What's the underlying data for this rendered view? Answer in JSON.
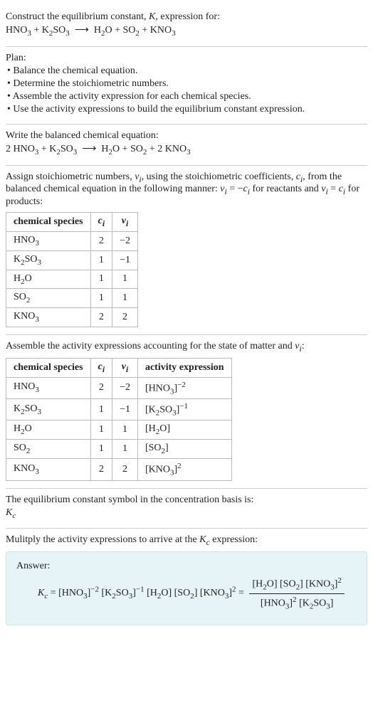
{
  "intro": {
    "lead": "Construct the equilibrium constant, K, expression for:",
    "equation": "HNO₃ + K₂SO₃ ⟶ H₂O + SO₂ + KNO₃"
  },
  "plan": {
    "heading": "Plan:",
    "items": [
      "• Balance the chemical equation.",
      "• Determine the stoichiometric numbers.",
      "• Assemble the activity expression for each chemical species.",
      "• Use the activity expressions to build the equilibrium constant expression."
    ]
  },
  "balanced": {
    "heading": "Write the balanced chemical equation:",
    "equation": "2 HNO₃ + K₂SO₃ ⟶ H₂O + SO₂ + 2 KNO₃"
  },
  "stoich": {
    "intro_before": "Assign stoichiometric numbers, νᵢ, using the stoichiometric coefficients, cᵢ, from the balanced chemical equation in the following manner: νᵢ = −cᵢ for reactants and νᵢ = cᵢ for products:",
    "headers": {
      "species": "chemical species",
      "ci": "cᵢ",
      "vi": "νᵢ"
    },
    "rows": [
      {
        "species": "HNO₃",
        "ci": "2",
        "vi": "−2"
      },
      {
        "species": "K₂SO₃",
        "ci": "1",
        "vi": "−1"
      },
      {
        "species": "H₂O",
        "ci": "1",
        "vi": "1"
      },
      {
        "species": "SO₂",
        "ci": "1",
        "vi": "1"
      },
      {
        "species": "KNO₃",
        "ci": "2",
        "vi": "2"
      }
    ]
  },
  "activity": {
    "intro": "Assemble the activity expressions accounting for the state of matter and νᵢ:",
    "headers": {
      "species": "chemical species",
      "ci": "cᵢ",
      "vi": "νᵢ",
      "act": "activity expression"
    },
    "rows": [
      {
        "species": "HNO₃",
        "ci": "2",
        "vi": "−2",
        "act": "[HNO₃]⁻²"
      },
      {
        "species": "K₂SO₃",
        "ci": "1",
        "vi": "−1",
        "act": "[K₂SO₃]⁻¹"
      },
      {
        "species": "H₂O",
        "ci": "1",
        "vi": "1",
        "act": "[H₂O]"
      },
      {
        "species": "SO₂",
        "ci": "1",
        "vi": "1",
        "act": "[SO₂]"
      },
      {
        "species": "KNO₃",
        "ci": "2",
        "vi": "2",
        "act": "[KNO₃]²"
      }
    ]
  },
  "symbol": {
    "line1": "The equilibrium constant symbol in the concentration basis is:",
    "line2": "K𝑐"
  },
  "multiply": {
    "heading": "Mulitply the activity expressions to arrive at the K𝑐 expression:"
  },
  "answer": {
    "label": "Answer:",
    "lhs": "K𝑐 = [HNO₃]⁻² [K₂SO₃]⁻¹ [H₂O] [SO₂] [KNO₃]² =",
    "frac_num": "[H₂O] [SO₂] [KNO₃]²",
    "frac_den": "[HNO₃]² [K₂SO₃]"
  }
}
